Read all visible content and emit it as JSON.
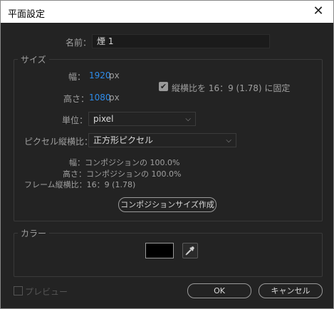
{
  "window": {
    "title": "平面設定",
    "close_glyph": "✕"
  },
  "name_row": {
    "label": "名前：",
    "value": "煙 1"
  },
  "size_section": {
    "legend": "サイズ",
    "width_label": "幅：",
    "width_value": "1920",
    "width_unit": "px",
    "height_label": "高さ：",
    "height_value": "1080",
    "height_unit": "px",
    "lock_aspect_label": "縦横比を 16：9 (1.78) に固定",
    "lock_aspect_checked": true,
    "units_label": "単位：",
    "units_value": "pixel",
    "pixel_aspect_label": "ピクセル縦横比：",
    "pixel_aspect_value": "正方形ピクセル",
    "info_width": "幅：コンポジションの 100.0%",
    "info_height": "高さ：コンポジションの 100.0%",
    "info_frame_aspect": "フレーム縦横比：16：9 (1.78)",
    "make_comp_size_button": "コンポジションサイズ作成"
  },
  "color_section": {
    "legend": "カラー",
    "swatch_color": "#000000",
    "eyedropper_icon": "eyedropper-icon"
  },
  "footer": {
    "preview_label": "プレビュー",
    "preview_checked": false,
    "ok_label": "OK",
    "cancel_label": "キャンセル"
  }
}
